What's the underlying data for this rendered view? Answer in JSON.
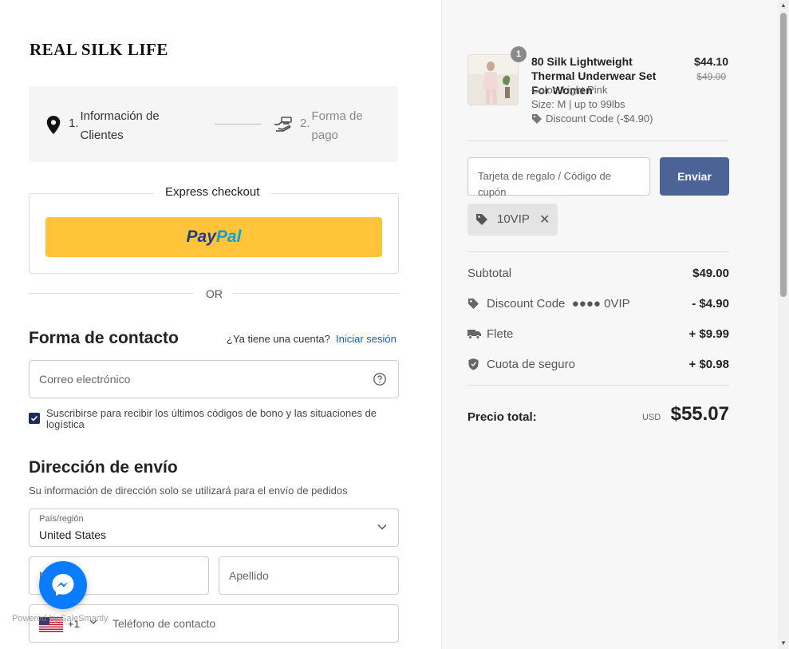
{
  "brand": "REAL SILK LIFE",
  "steps": [
    {
      "num": "1.",
      "label": "Información de Clientes"
    },
    {
      "num": "2.",
      "label": "Forma de pago"
    }
  ],
  "express": {
    "title": "Express checkout",
    "paypal_a": "Pay",
    "paypal_b": "Pal"
  },
  "or_label": "OR",
  "contact": {
    "title": "Forma de contacto",
    "have_account": "¿Ya tiene una cuenta?",
    "login": "Iniciar sesión",
    "email_placeholder": "Correo electrónico",
    "subscribe_label": "Suscribirse para recibir los últimos códigos de bono y las situaciones de logística",
    "subscribe_checked": true
  },
  "shipping": {
    "title": "Dirección de envío",
    "note": "Su información de dirección solo se utilizará para el envío de pedidos",
    "country_label": "País/región",
    "country_value": "United States",
    "first_name_placeholder": "N",
    "last_name_placeholder": "Apellido",
    "dial_code": "+1",
    "phone_placeholder": "Teléfono de contacto"
  },
  "powered_by": "Powered by SaleSmartly",
  "product": {
    "qty": "1",
    "name": "80 Silk Lightweight Thermal Underwear Set For Women",
    "color": "Color: Light Pink",
    "size": "Size: M | up to 99lbs",
    "discount": "Discount Code  (-$4.90)",
    "price": "$44.10",
    "old_price": "$49.00"
  },
  "coupon": {
    "placeholder": "Tarjeta de regalo / Código de cupón",
    "button": "Enviar",
    "applied_code": "10VIP"
  },
  "summary": {
    "subtotal_label": "Subtotal",
    "subtotal_value": "$49.00",
    "discount_label": "Discount Code",
    "discount_code": "●●●● 0VIP",
    "discount_value": "- $4.90",
    "shipping_label": "Flete",
    "shipping_value": "+ $9.99",
    "insurance_label": "Cuota de seguro",
    "insurance_value": "+ $0.98",
    "total_label": "Precio total:",
    "currency": "USD",
    "total_value": "$55.07"
  },
  "colors": {
    "accent": "#4b6396",
    "paypal": "#ffc439",
    "checkbox": "#1d2a5d",
    "messenger": "#0a7cff",
    "link": "#1a5fa8"
  }
}
